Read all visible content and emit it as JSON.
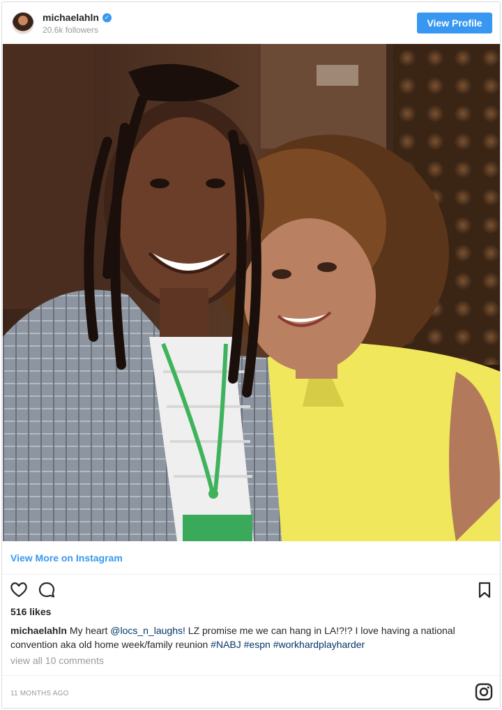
{
  "header": {
    "username": "michaelahln",
    "verified_icon": "verified-badge-icon",
    "followers": "20.6k followers",
    "view_profile_label": "View Profile"
  },
  "post": {
    "photo_description_icon": "post-photo",
    "view_more_label": "View More on Instagram",
    "likes": "516 likes",
    "caption": {
      "username": "michaelahln",
      "text_1": "My heart ",
      "mention": "@locs_n_laughs!",
      "text_2": " LZ promise me we can hang in LA!?!? I love having a national convention aka old home week/family reunion ",
      "hashtag_1": "#NABJ",
      "space_1": " ",
      "hashtag_2": "#espn",
      "space_2": " ",
      "hashtag_3": "#workhardplayharder"
    },
    "view_comments": "view all 10 comments",
    "timestamp": "11 MONTHS AGO"
  },
  "icons": {
    "like": "heart-icon",
    "comment": "comment-icon",
    "save": "bookmark-icon",
    "instagram": "instagram-logo-icon"
  },
  "colors": {
    "accent": "#3897f0",
    "text": "#262626",
    "muted": "#999999",
    "hashtag": "#003569"
  }
}
